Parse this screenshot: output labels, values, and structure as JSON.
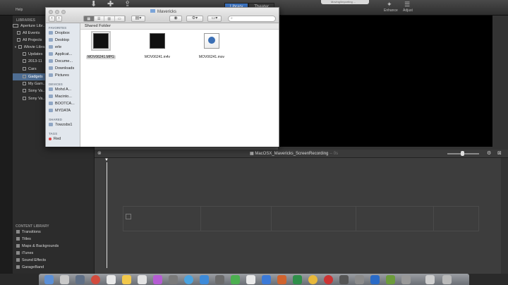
{
  "app_toolbar": {
    "help_label": "Help",
    "tabs": [
      {
        "label": "Library",
        "active": true
      },
      {
        "label": "Theater",
        "active": false
      }
    ],
    "progress_text": "Moving/Importing ...",
    "enhance_label": "Enhance",
    "adjust_label": "Adjust",
    "icons": [
      "import-arrow-icon",
      "add-icon",
      "share-icon"
    ]
  },
  "libraries": {
    "title": "LIBRARIES",
    "items": [
      {
        "label": "Aperture Libr..."
      },
      {
        "label": "All Events"
      },
      {
        "label": "All Projects"
      },
      {
        "label": "iMovie Library"
      },
      {
        "label": "Updates"
      },
      {
        "label": "2013-11"
      },
      {
        "label": "Cars"
      },
      {
        "label": "Gadgets",
        "selected": true
      },
      {
        "label": "My Gam..."
      },
      {
        "label": "Sony Va..."
      },
      {
        "label": "Sony Va..."
      }
    ]
  },
  "content_library": {
    "title": "CONTENT LIBRARY",
    "items": [
      {
        "label": "Transitions"
      },
      {
        "label": "Titles"
      },
      {
        "label": "Maps & Backgrounds"
      },
      {
        "label": "iTunes"
      },
      {
        "label": "Sound Effects"
      },
      {
        "label": "GarageBand"
      }
    ]
  },
  "finder": {
    "title": "Mavericks",
    "search_placeholder": "",
    "view_modes": [
      "icon",
      "list",
      "column",
      "cover-flow"
    ],
    "sidebar": {
      "favorites_title": "FAVORITES",
      "favorites": [
        "Dropbox",
        "Desktop",
        "erle",
        "Applicat...",
        "Docume...",
        "Downloads",
        "Pictures"
      ],
      "devices_title": "DEVICES",
      "devices": [
        "Mohd A...",
        "Macinto...",
        "BOOTCA...",
        "MYDATA"
      ],
      "shared_title": "SHARED",
      "shared": [
        "7owzsbs1"
      ],
      "tags_title": "TAGS",
      "tags": [
        "Red"
      ]
    },
    "content_title": "Shared Folder",
    "files": [
      {
        "name": "MOV06241.MPG",
        "selected": true,
        "kind": "video"
      },
      {
        "name": "MOV06241.m4v",
        "selected": false,
        "kind": "video"
      },
      {
        "name": "MOV06241.mov",
        "selected": false,
        "kind": "mov"
      }
    ]
  },
  "timeline": {
    "project_title": "MacOSX_Mavericks_ScreenRecording",
    "duration": "-- 0s"
  },
  "colors": {
    "accent": "#3d77c9",
    "selection": "#4e6d92",
    "viewer_bg": "#000000",
    "timeline_bg": "#3d3d3d"
  }
}
